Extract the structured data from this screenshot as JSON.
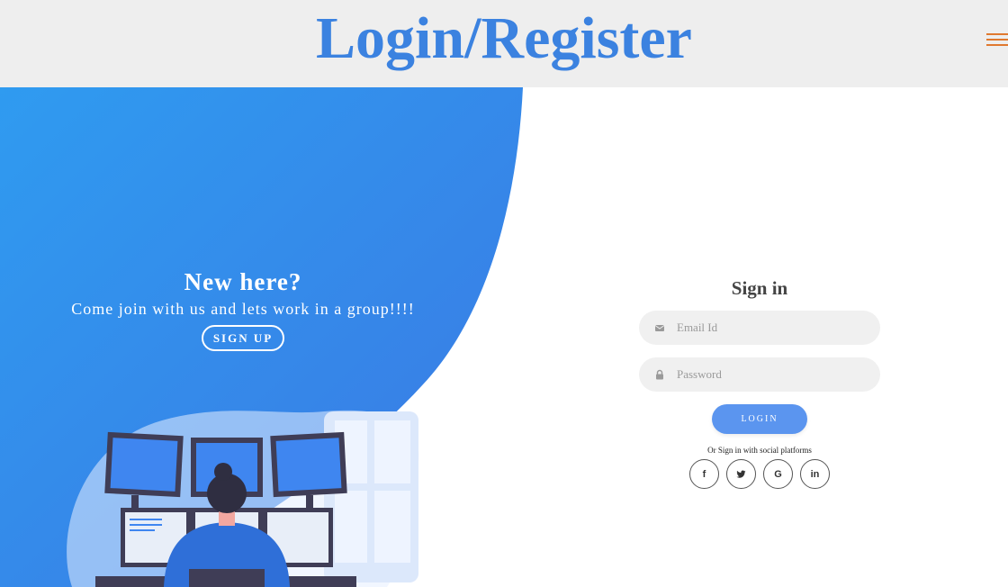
{
  "header": {
    "title": "Login/Register",
    "menu_icon": "hamburger-menu-icon",
    "title_color": "#3b82e0",
    "menu_color": "#e0792f"
  },
  "promo": {
    "title": "New here?",
    "subtitle": "Come join with us and lets work in a group!!!!",
    "signup_label": "SIGN UP",
    "panel_color_start": "#2f9bf0",
    "panel_color_end": "#3b78e3"
  },
  "signin": {
    "title": "Sign in",
    "email": {
      "placeholder": "Email Id",
      "value": "",
      "icon": "envelope-icon"
    },
    "password": {
      "placeholder": "Password",
      "value": "",
      "icon": "lock-icon"
    },
    "login_label": "LOGIN",
    "social_text": "Or Sign in with social platforms",
    "social": [
      {
        "name": "facebook",
        "glyph": "f",
        "icon": "facebook-icon"
      },
      {
        "name": "twitter",
        "glyph": "",
        "icon": "twitter-icon"
      },
      {
        "name": "google",
        "glyph": "G",
        "icon": "google-icon"
      },
      {
        "name": "linkedin",
        "glyph": "in",
        "icon": "linkedin-icon"
      }
    ],
    "button_color": "#5b95ef"
  }
}
